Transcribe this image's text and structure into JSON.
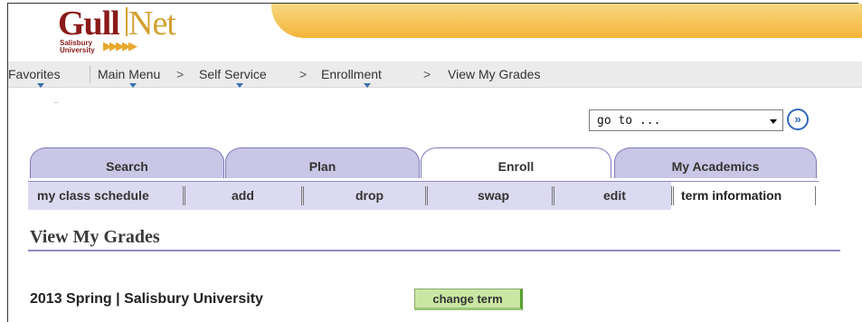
{
  "logo": {
    "brand_part1": "Gull",
    "brand_part2": "Net",
    "institution_line1": "Salisbury",
    "institution_line2": "University",
    "arrows": "▶▶▶▶▶"
  },
  "breadcrumb": {
    "items": [
      {
        "label": "Favorites"
      },
      {
        "label": "Main Menu"
      },
      {
        "label": "Self Service"
      },
      {
        "label": "Enrollment"
      },
      {
        "label": "View My Grades"
      }
    ],
    "separator": ">"
  },
  "goto": {
    "value": "go to ...",
    "button_glyph": "»"
  },
  "tabs": [
    {
      "label": "Search",
      "active": false
    },
    {
      "label": "Plan",
      "active": false
    },
    {
      "label": "Enroll",
      "active": true
    },
    {
      "label": "My Academics",
      "active": false
    }
  ],
  "subtabs": [
    {
      "label": "my class schedule"
    },
    {
      "label": "add"
    },
    {
      "label": "drop"
    },
    {
      "label": "swap"
    },
    {
      "label": "edit"
    },
    {
      "label": "term information"
    }
  ],
  "page_title": "View My Grades",
  "term": {
    "label": "2013 Spring | Salisbury University",
    "change_button": "change term"
  },
  "colors": {
    "banner": "#f4b53a",
    "tab_bg": "#c9c6e6",
    "tab_border": "#7e79b8",
    "subtab_bg": "#dcdaf0",
    "button_green": "#c9e7a3",
    "brand_red": "#8b1a1a",
    "brand_gold": "#d4a030"
  }
}
